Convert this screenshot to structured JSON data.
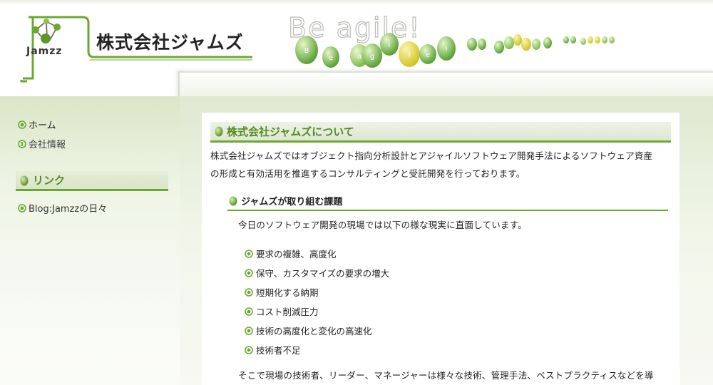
{
  "header": {
    "company_name": "株式会社ジャムズ",
    "logo_text": "Jamzz",
    "banner_text": "Be agile!",
    "banner_egg_letters": [
      "B",
      "e",
      "a",
      "g",
      "i",
      "l",
      "e",
      "!"
    ],
    "accent_color": "#6aa830"
  },
  "sidebar": {
    "nav": [
      {
        "label": "ホーム",
        "icon": "circle-bullet-icon"
      },
      {
        "label": "会社情報",
        "icon": "info-bullet-icon"
      }
    ],
    "links_heading": "リンク",
    "links": [
      {
        "label": "Blog:Jamzzの日々",
        "icon": "circle-bullet-icon"
      }
    ]
  },
  "main": {
    "section_title": "株式会社ジャムズについて",
    "intro_line1": "株式会社ジャムズではオブジェクト指向分析設計とアジャイルソフトウェア開発手法によるソフトウェア資産",
    "intro_line2": "の形成と有効活用を推進するコンサルティングと受託開発を行っております。",
    "sub_title": "ジャムズが取り組む課題",
    "challenge_intro": "今日のソフトウェア開発の現場では以下の様な現実に直面しています。",
    "issues": [
      "要求の複雑、高度化",
      "保守、カスタマイズの要求の増大",
      "短期化する納期",
      "コスト削減圧力",
      "技術の高度化と変化の高速化",
      "技術者不足"
    ],
    "closing": "そこで現場の技術者、リーダー、マネージャーは様々な技術、管理手法、ベストプラクティスなどを導"
  }
}
